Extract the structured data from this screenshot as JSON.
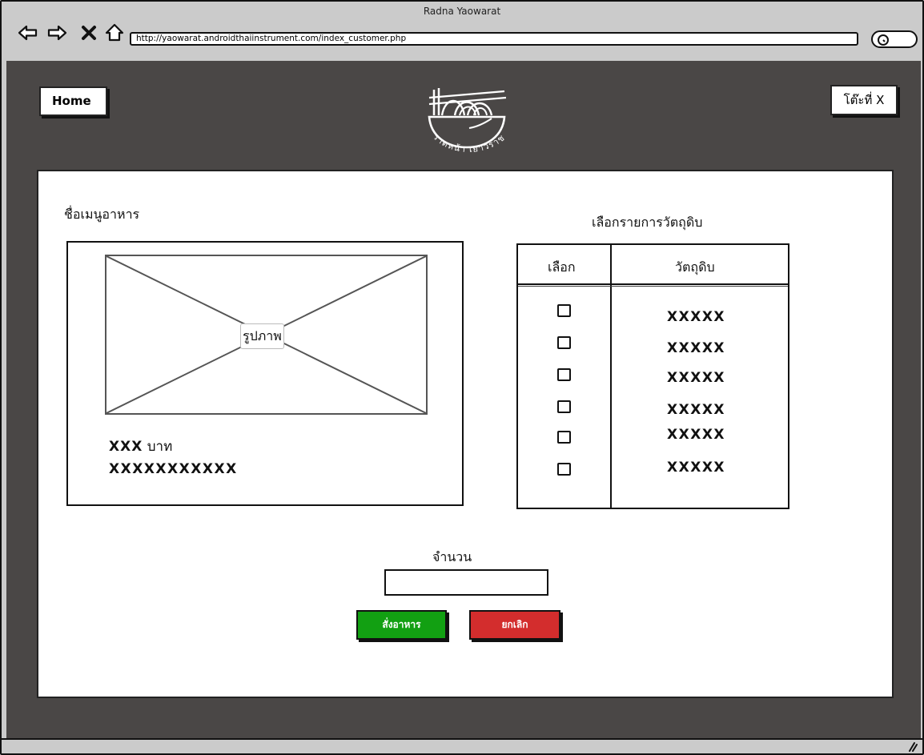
{
  "window": {
    "title": "Radna Yaowarat",
    "url": "http://yaowarat.androidthaiinstrument.com/index_customer.php"
  },
  "icons": {
    "back": "back-arrow-icon",
    "forward": "forward-arrow-icon",
    "stop": "close-icon",
    "home": "home-icon",
    "search": "search-icon",
    "logo": "noodle-bowl-logo-icon",
    "resize": "resize-grip-icon"
  },
  "header": {
    "home_label": "Home",
    "table_label": "โต๊ะที่ X",
    "logo_text": "ราดหน้า เยาวราช"
  },
  "menu": {
    "name_label": "ชื่อเมนูอาหาร",
    "image_label": "รูปภาพ",
    "price_value": "XXX",
    "price_unit": "บาท",
    "description": "XXXXXXXXXXX"
  },
  "ingredients": {
    "title": "เลือกรายการวัตถุดิบ",
    "col_select": "เลือก",
    "col_ingredient": "วัตถุดิบ",
    "items": [
      "XXXXX",
      "XXXXX",
      "XXXXX",
      "XXXXX",
      "XXXXX",
      "XXXXX"
    ],
    "checked": [
      false,
      false,
      false,
      false,
      false,
      false
    ]
  },
  "order": {
    "quantity_label": "จำนวน",
    "quantity_value": "",
    "order_label": "สั่งอาหาร",
    "cancel_label": "ยกเลิก"
  },
  "colors": {
    "background": "#4a4746",
    "order_button": "#12a012",
    "cancel_button": "#d32d2d",
    "chrome": "#cbcbcb"
  }
}
